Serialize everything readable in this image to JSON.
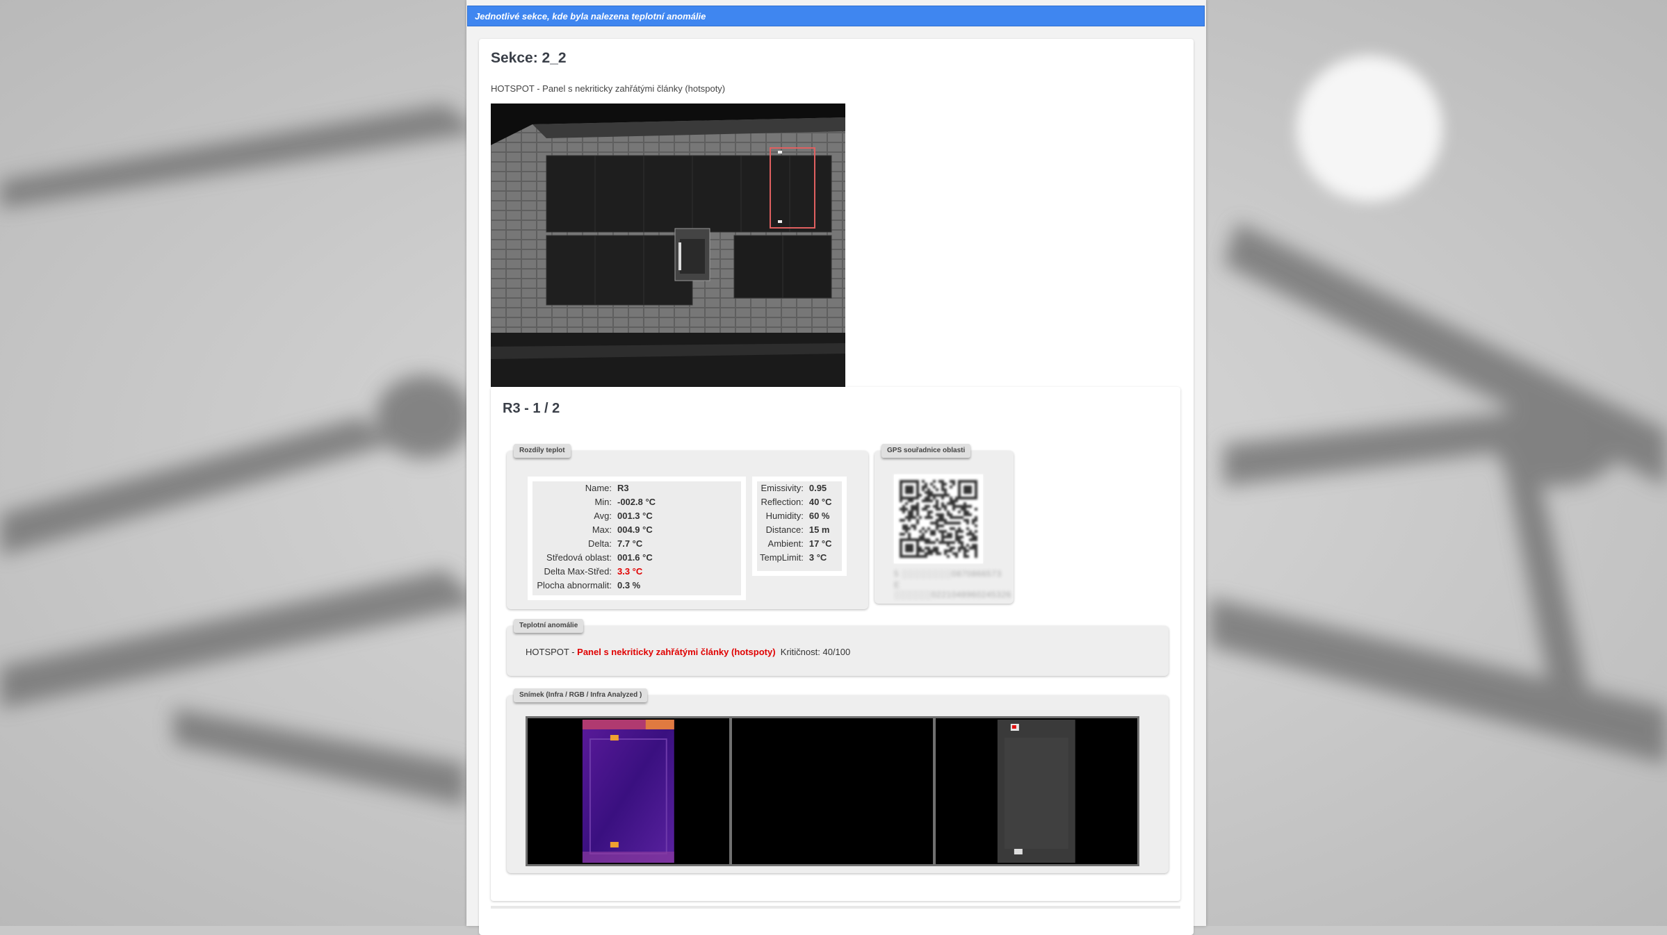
{
  "header": {
    "title": "Jednotlivé sekce, kde byla nalezena teplotní anomálie"
  },
  "section": {
    "title": "Sekce: 2_2",
    "subtitle": "HOTSPOT - Panel s nekriticky zahřátými články (hotspoty)"
  },
  "item": {
    "title": "R3 - 1 / 2"
  },
  "temperature": {
    "legend": "Rozdíly teplot",
    "rows": [
      {
        "label": "Name:",
        "value": "R3"
      },
      {
        "label": "Min:",
        "value": "-002.8 °C"
      },
      {
        "label": "Avg:",
        "value": "001.3 °C"
      },
      {
        "label": "Max:",
        "value": "004.9 °C"
      },
      {
        "label": "Delta:",
        "value": "7.7 °C"
      },
      {
        "label": "Středová oblast:",
        "value": "001.6 °C"
      },
      {
        "label": "Delta Max-Střed:",
        "value": "3.3 °C"
      },
      {
        "label": "Plocha abnormalit:",
        "value": "0.3 %"
      }
    ],
    "params": [
      {
        "label": "Emissivity:",
        "value": "0.95"
      },
      {
        "label": "Reflection:",
        "value": "40 °C"
      },
      {
        "label": "Humidity:",
        "value": "60 %"
      },
      {
        "label": "Distance:",
        "value": "15 m"
      },
      {
        "label": "Ambient:",
        "value": "17 °C"
      },
      {
        "label": "TempLimit:",
        "value": "3 °C"
      }
    ]
  },
  "gps": {
    "legend": "GPS souřadnice oblasti",
    "line1": "5 ░░░░░░░░0870866573",
    "line2": "E ░░░░░░0221048960245326"
  },
  "anomaly": {
    "legend": "Teplotní anomálie",
    "prefix": "HOTSPOT - ",
    "name": "Panel s nekriticky zahřátými články (hotspoty)",
    "criticality": "Kritičnost: 40/100"
  },
  "images": {
    "legend": "Snímek (Infra / RGB / Infra Analyzed )"
  },
  "colors": {
    "header_blue": "#3f86f0",
    "alert_red": "#e00000",
    "highlight_box": "#e06060"
  }
}
